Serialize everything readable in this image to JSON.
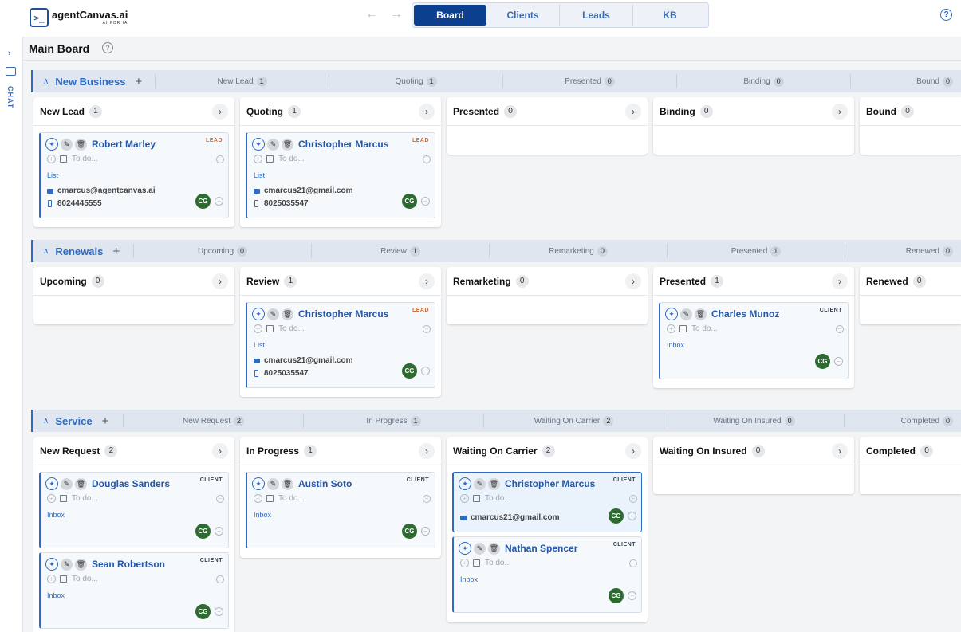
{
  "app": {
    "logo_mark": ">_",
    "title": "agentCanvas.ai",
    "subtitle": "AI FOR IA",
    "back_icon": "←",
    "forward_icon": "→",
    "help_icon": "?",
    "tabs": [
      "Board",
      "Clients",
      "Leads",
      "KB"
    ],
    "active_tab": "Board"
  },
  "sidebar": {
    "chevron": "›",
    "chat_label": "CHAT"
  },
  "page": {
    "title": "Main Board",
    "help_icon": "?"
  },
  "glyphs": {
    "caret": "∧",
    "plus": "+",
    "chevron": "›",
    "ai": "✦",
    "edit": "✎",
    "delete": "🗑",
    "circle_plus": "+",
    "circle_minus": "−"
  },
  "sections": [
    {
      "title": "New Business",
      "stages": [
        {
          "label": "New Lead",
          "count": "1"
        },
        {
          "label": "Quoting",
          "count": "1"
        },
        {
          "label": "Presented",
          "count": "0"
        },
        {
          "label": "Binding",
          "count": "0"
        },
        {
          "label": "Bound",
          "count": "0"
        }
      ],
      "columns": [
        {
          "title": "New Lead",
          "count": "1"
        },
        {
          "title": "Quoting",
          "count": "1"
        },
        {
          "title": "Presented",
          "count": "0"
        },
        {
          "title": "Binding",
          "count": "0"
        },
        {
          "title": "Bound",
          "count": "0"
        }
      ]
    },
    {
      "title": "Renewals",
      "stages": [
        {
          "label": "Upcoming",
          "count": "0"
        },
        {
          "label": "Review",
          "count": "1"
        },
        {
          "label": "Remarketing",
          "count": "0"
        },
        {
          "label": "Presented",
          "count": "1"
        },
        {
          "label": "Renewed",
          "count": "0"
        }
      ],
      "columns": [
        {
          "title": "Upcoming",
          "count": "0"
        },
        {
          "title": "Review",
          "count": "1"
        },
        {
          "title": "Remarketing",
          "count": "0"
        },
        {
          "title": "Presented",
          "count": "1"
        },
        {
          "title": "Renewed",
          "count": "0"
        }
      ]
    },
    {
      "title": "Service",
      "stages": [
        {
          "label": "New Request",
          "count": "2"
        },
        {
          "label": "In Progress",
          "count": "1"
        },
        {
          "label": "Waiting On Carrier",
          "count": "2"
        },
        {
          "label": "Waiting On Insured",
          "count": "0"
        },
        {
          "label": "Completed",
          "count": "0"
        }
      ],
      "columns": [
        {
          "title": "New Request",
          "count": "2"
        },
        {
          "title": "In Progress",
          "count": "1"
        },
        {
          "title": "Waiting On Carrier",
          "count": "2"
        },
        {
          "title": "Waiting On Insured",
          "count": "0"
        },
        {
          "title": "Completed",
          "count": "0"
        }
      ]
    }
  ],
  "cards": {
    "robert": {
      "name": "Robert Marley",
      "tag": "LEAD",
      "todo": "To do...",
      "link": "List",
      "email": "cmarcus@agentcanvas.ai",
      "phone": "8024445555",
      "avatar": "CG"
    },
    "christopher_q": {
      "name": "Christopher Marcus",
      "tag": "LEAD",
      "todo": "To do...",
      "link": "List",
      "email": "cmarcus21@gmail.com",
      "phone": "8025035547",
      "avatar": "CG"
    },
    "christopher_r": {
      "name": "Christopher Marcus",
      "tag": "LEAD",
      "todo": "To do...",
      "link": "List",
      "email": "cmarcus21@gmail.com",
      "phone": "8025035547",
      "avatar": "CG"
    },
    "charles": {
      "name": "Charles Munoz",
      "tag": "CLIENT",
      "todo": "To do...",
      "link": "Inbox",
      "avatar": "CG"
    },
    "douglas": {
      "name": "Douglas Sanders",
      "tag": "CLIENT",
      "todo": "To do...",
      "link": "Inbox",
      "avatar": "CG"
    },
    "sean": {
      "name": "Sean Robertson",
      "tag": "CLIENT",
      "todo": "To do...",
      "link": "Inbox",
      "avatar": "CG"
    },
    "austin": {
      "name": "Austin Soto",
      "tag": "CLIENT",
      "todo": "To do...",
      "link": "Inbox",
      "avatar": "CG"
    },
    "christopher_w": {
      "name": "Christopher Marcus",
      "tag": "CLIENT",
      "todo": "To do...",
      "email": "cmarcus21@gmail.com",
      "avatar": "CG"
    },
    "nathan": {
      "name": "Nathan Spencer",
      "tag": "CLIENT",
      "todo": "To do...",
      "link": "Inbox",
      "avatar": "CG"
    }
  }
}
